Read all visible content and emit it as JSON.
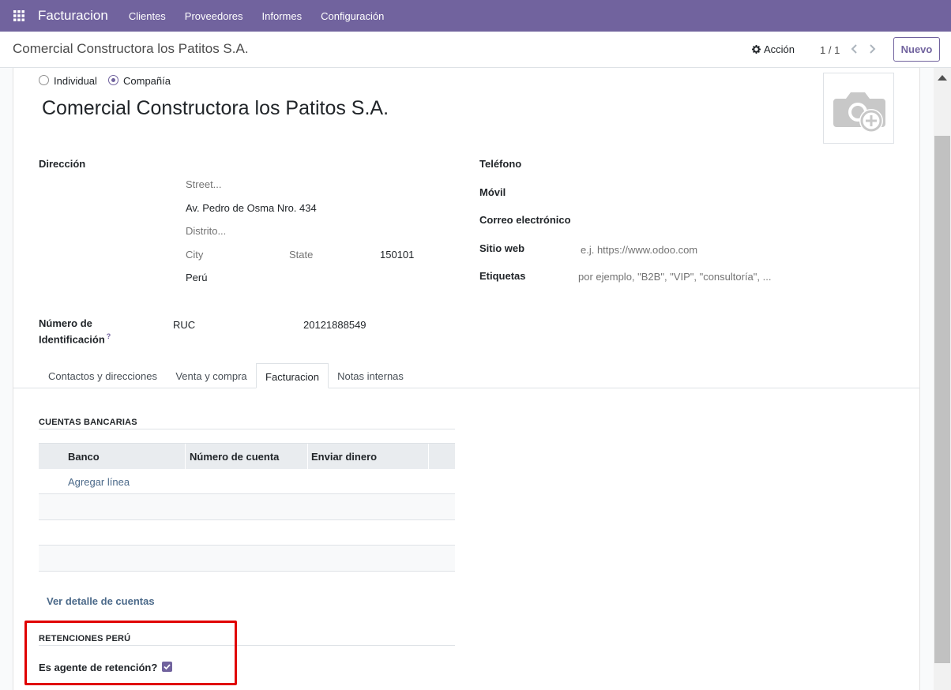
{
  "navbar": {
    "brand": "Facturacion",
    "menu": [
      "Clientes",
      "Proveedores",
      "Informes",
      "Configuración"
    ]
  },
  "control_panel": {
    "breadcrumb": "Comercial Constructora los Patitos S.A.",
    "action_label": "Acción",
    "pager": "1 / 1",
    "new_label": "Nuevo"
  },
  "form": {
    "company_type": {
      "individual_label": "Individual",
      "company_label": "Compañía",
      "selected": "Compañía"
    },
    "name": "Comercial Constructora los Patitos S.A.",
    "address": {
      "label": "Dirección",
      "street_placeholder": "Street...",
      "street2": "Av. Pedro de Osma Nro. 434",
      "district_placeholder": "Distrito...",
      "city_placeholder": "City",
      "state_placeholder": "State",
      "zip": "150101",
      "country": "Perú"
    },
    "phone_label": "Teléfono",
    "mobile_label": "Móvil",
    "email_label": "Correo electrónico",
    "website_label": "Sitio web",
    "website_placeholder": "e.j. https://www.odoo.com",
    "tags_label": "Etiquetas",
    "tags_placeholder": "por ejemplo, \"B2B\", \"VIP\", \"consultoría\", ...",
    "id_label_line1": "Número de",
    "id_label_line2": "Identificación",
    "id_help": "?",
    "id_type": "RUC",
    "id_number": "20121888549"
  },
  "tabs": [
    {
      "label": "Contactos y direcciones",
      "active": false
    },
    {
      "label": "Venta y compra",
      "active": false
    },
    {
      "label": "Facturacion",
      "active": true
    },
    {
      "label": "Notas internas",
      "active": false
    }
  ],
  "bank_accounts": {
    "title": "CUENTAS BANCARIAS",
    "columns": [
      "Banco",
      "Número de cuenta",
      "Enviar dinero"
    ],
    "add_line": "Agregar línea",
    "detail_link": "Ver detalle de cuentas"
  },
  "retentions": {
    "title": "RETENCIONES PERÚ",
    "agent_label": "Es agente de retención?",
    "agent_checked": true
  },
  "colors": {
    "brand": "#71639e",
    "highlight_box": "#e00000"
  }
}
